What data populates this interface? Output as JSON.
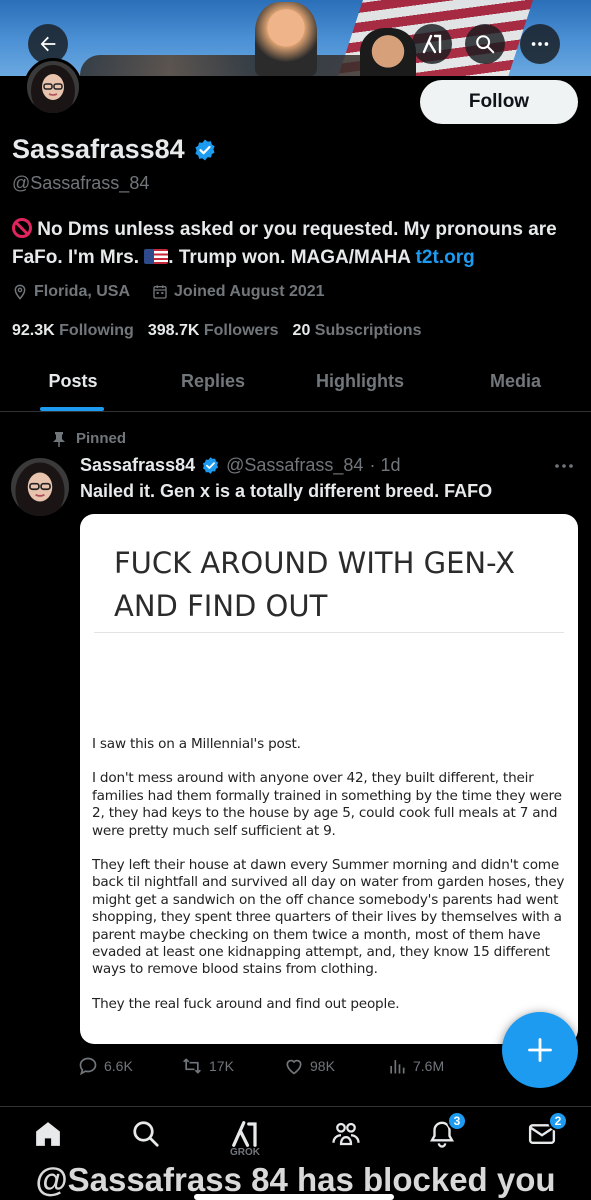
{
  "header": {
    "back_icon": "arrow-left-icon",
    "grok_icon": "grok-icon",
    "search_icon": "search-icon",
    "more_icon": "more-icon"
  },
  "profile": {
    "display_name": "Sassafrass84",
    "handle": "@Sassafrass_84",
    "follow_label": "Follow",
    "bio_part1": "No Dms unless asked or you requested. My pronouns are FaFo. I'm Mrs. ",
    "bio_part2": ". Trump won. MAGA/MAHA ",
    "bio_link": "t2t.org",
    "location": "Florida, USA",
    "joined": "Joined August 2021",
    "following_count": "92.3K",
    "following_label": "Following",
    "followers_count": "398.7K",
    "followers_label": "Followers",
    "subscriptions_count": "20",
    "subscriptions_label": "Subscriptions",
    "verified_color": "#1d9bf0"
  },
  "tabs": [
    {
      "label": "Posts",
      "active": true
    },
    {
      "label": "Replies",
      "active": false
    },
    {
      "label": "Highlights",
      "active": false
    },
    {
      "label": "Media",
      "active": false
    }
  ],
  "post": {
    "pinned_label": "Pinned",
    "author_name": "Sassafrass84",
    "author_handle": "@Sassafrass_84",
    "time": "· 1d",
    "text": "Nailed it. Gen x is a totally different breed. FAFO",
    "image": {
      "title": "FUCK AROUND WITH GEN-X AND FIND OUT",
      "paragraphs": [
        "I saw this on a Millennial's post.",
        "I don't mess around with anyone over 42, they built different, their families had them formally trained in something by the time they were 2, they had keys to the house by age 5, could cook full meals at 7 and were pretty much self sufficient at 9.",
        "They left their house at dawn every Summer morning and didn't come back til nightfall and survived all day on water from garden hoses, they might get a sandwich on the off chance somebody's parents had went shopping, they spent three quarters of their lives by themselves with a parent maybe checking on them twice a month, most of them have evaded at least one kidnapping attempt, and, they know 15 different ways to remove blood stains from clothing.",
        "They the real fuck around and find out people."
      ]
    },
    "replies": "6.6K",
    "reposts": "17K",
    "likes": "98K",
    "views": "7.6M"
  },
  "bottom_nav": {
    "grok_label": "GROK",
    "notifications_badge": "3",
    "messages_badge": "2"
  },
  "overlay_caption": "@Sassafrass 84 has blocked you"
}
